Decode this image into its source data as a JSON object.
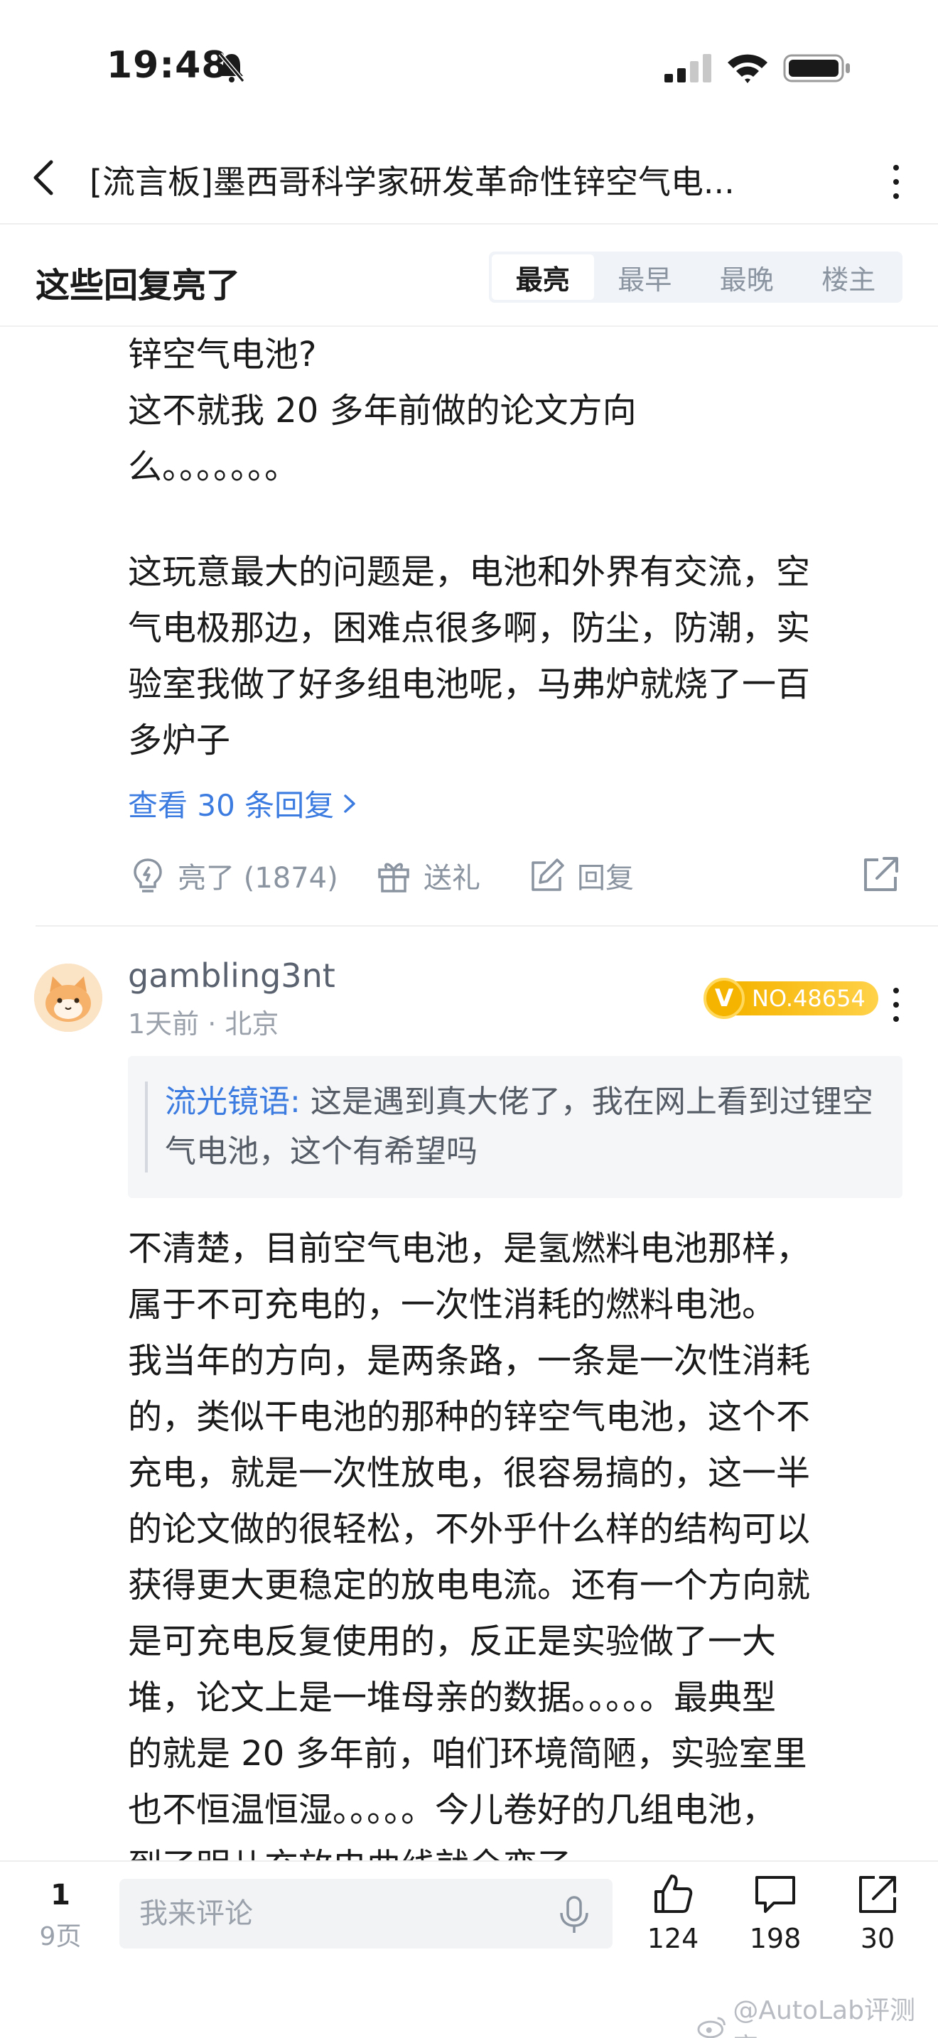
{
  "status_bar": {
    "time": "19:48"
  },
  "nav": {
    "title": "[流言板]墨西哥科学家研发革命性锌空气电..."
  },
  "sort_header": {
    "title": "这些回复亮了",
    "tabs": [
      "最亮",
      "最早",
      "最晚",
      "楼主"
    ],
    "active_tab": "最亮"
  },
  "post": {
    "text_top": "锌空气电池?\n这不就我 20 多年前做的论文方向\n么。。。。。。。",
    "text_body": "这玩意最大的问题是，电池和外界有交流，空\n气电极那边，困难点很多啊，防尘，防潮，实\n验室我做了好多组电池呢，马弗炉就烧了一百\n多炉子",
    "view_replies": "查看 30 条回复",
    "actions": {
      "like": "亮了 (1874)",
      "gift": "送礼",
      "reply": "回复"
    }
  },
  "comment": {
    "username": "gambling3nt",
    "meta": "1天前 · 北京",
    "badge_no": "NO.48654",
    "quote_author": "流光镜语:",
    "quote_text": " 这是遇到真大佬了，我在网上看到过锂空气电池，这个有希望吗",
    "text": "不清楚，目前空气电池，是氢燃料电池那样，\n属于不可充电的，一次性消耗的燃料电池。\n我当年的方向，是两条路，一条是一次性消耗\n的，类似干电池的那种的锌空气电池，这个不\n充电，就是一次性放电，很容易搞的，这一半\n的论文做的很轻松，不外乎什么样的结构可以\n获得更大更稳定的放电电流。还有一个方向就\n是可充电反复使用的，反正是实验做了一大\n堆，论文上是一堆母亲的数据。。。。。最典型\n的就是 20 多年前，咱们环境简陋，实验室里\n也不恒温恒湿。。。。。今儿卷好的几组电池，\n到了明儿充放电曲线就全变了"
  },
  "bottom_bar": {
    "page_current": "1",
    "page_total": "9页",
    "input_placeholder": "我来评论",
    "like_count": "124",
    "comment_count": "198",
    "share_count": "30"
  },
  "watermark": "@AutoLab评测官",
  "colors": {
    "accent": "#3c7be0",
    "badge": "#f5b400"
  }
}
